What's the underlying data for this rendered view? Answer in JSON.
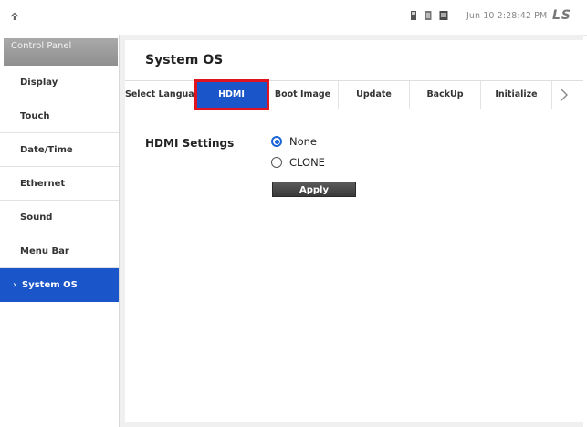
{
  "status_bar": {
    "datetime": "Jun 10 2:28:42 PM",
    "logo": "LS",
    "icons": [
      "signal-icon",
      "storage-icon",
      "device-icon"
    ]
  },
  "sidebar": {
    "header": "Control Panel",
    "items": [
      {
        "label": "Display",
        "active": false
      },
      {
        "label": "Touch",
        "active": false
      },
      {
        "label": "Date/Time",
        "active": false
      },
      {
        "label": "Ethernet",
        "active": false
      },
      {
        "label": "Sound",
        "active": false
      },
      {
        "label": "Menu Bar",
        "active": false
      },
      {
        "label": "System OS",
        "active": true
      }
    ]
  },
  "main": {
    "title": "System OS",
    "tabs": [
      {
        "label": "Select Language",
        "active": false
      },
      {
        "label": "HDMI",
        "active": true
      },
      {
        "label": "Boot Image",
        "active": false
      },
      {
        "label": "Update",
        "active": false
      },
      {
        "label": "BackUp",
        "active": false
      },
      {
        "label": "Initialize",
        "active": false
      }
    ],
    "hdmi": {
      "label": "HDMI Settings",
      "options": [
        {
          "label": "None",
          "selected": true
        },
        {
          "label": "CLONE",
          "selected": false
        }
      ],
      "apply_label": "Apply"
    }
  },
  "colors": {
    "accent": "#1a56c9",
    "highlight": "#e0141e",
    "sidebar_header": "#999999"
  }
}
